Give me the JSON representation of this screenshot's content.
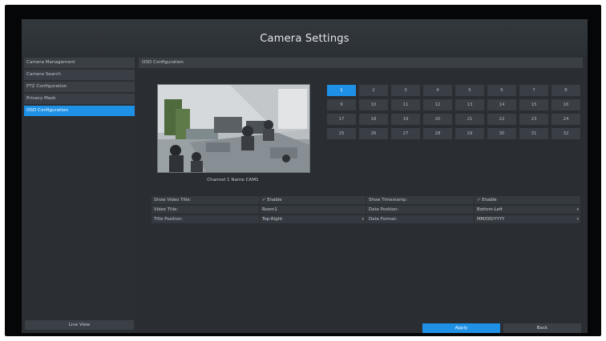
{
  "window": {
    "title": "Camera Settings"
  },
  "sidebar": {
    "items": [
      {
        "label": "Camera Management",
        "active": false
      },
      {
        "label": "Camera Search",
        "active": false
      },
      {
        "label": "PTZ Configuration",
        "active": false
      },
      {
        "label": "Privacy Mask",
        "active": false
      },
      {
        "label": "OSD Configuration",
        "active": true
      }
    ],
    "live_view_label": "Live View"
  },
  "main": {
    "section_title": "OSD Configuration",
    "preview": {
      "caption": "Channel 1 Name CAM1"
    },
    "channels": [
      "1",
      "2",
      "3",
      "4",
      "5",
      "6",
      "7",
      "8",
      "9",
      "10",
      "11",
      "12",
      "13",
      "14",
      "15",
      "16",
      "17",
      "18",
      "19",
      "20",
      "21",
      "22",
      "23",
      "24",
      "25",
      "26",
      "27",
      "28",
      "29",
      "30",
      "31",
      "32"
    ],
    "selected_channel": "1",
    "settings": {
      "show_video_title": {
        "label": "Show Video Title:",
        "value": "Enable"
      },
      "show_timestamp": {
        "label": "Show Timestamp:",
        "value": "Enable"
      },
      "video_title": {
        "label": "Video Title:",
        "value": "Room1"
      },
      "date_position": {
        "label": "Date Position:",
        "value": "Bottom-Left"
      },
      "title_position": {
        "label": "Title Position:",
        "value": "Top-Right"
      },
      "date_format": {
        "label": "Date Format:",
        "value": "MM/DD/YYYY"
      }
    },
    "apply_label": "Apply",
    "back_label": "Back"
  },
  "colors": {
    "accent": "#1e90e6",
    "panel": "#2b2f34",
    "row": "#3a3f45"
  }
}
